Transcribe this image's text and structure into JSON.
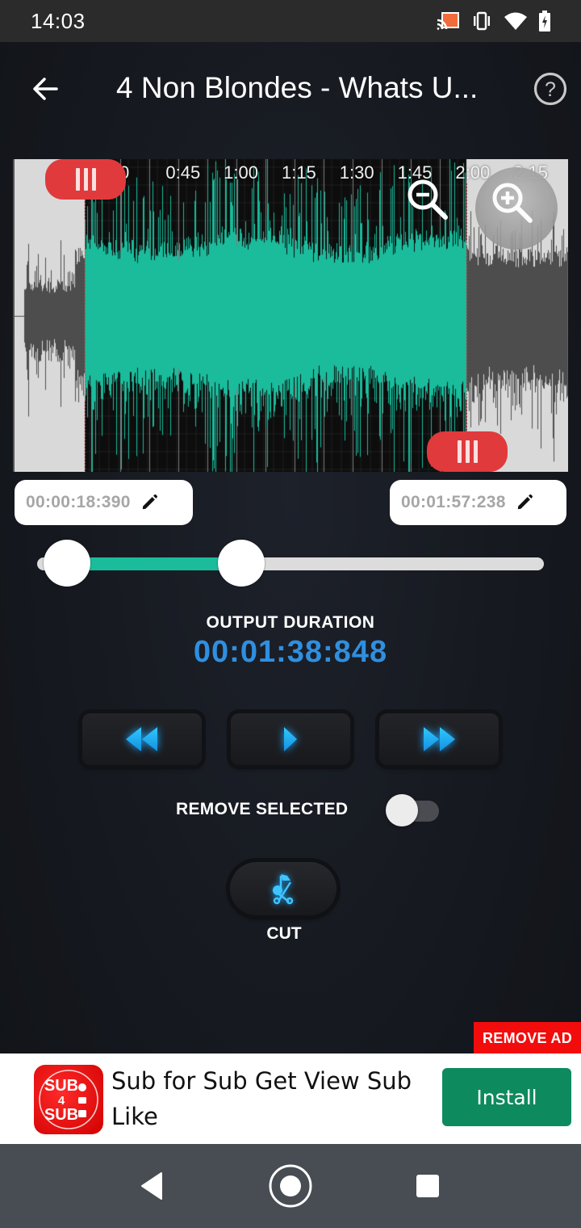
{
  "status_bar": {
    "time": "14:03",
    "icons": [
      "cast-icon",
      "vibrate-icon",
      "wifi-icon",
      "battery-charging-icon"
    ]
  },
  "toolbar": {
    "back_icon": "arrow-left-icon",
    "title": "4 Non Blondes - Whats U...",
    "help_icon": "help-circle-icon"
  },
  "waveform": {
    "time_labels": [
      ":30",
      "0:45",
      "1:00",
      "1:15",
      "1:30",
      "1:45",
      "2:00",
      "2:15"
    ],
    "selection_start_fraction": 0.127,
    "selection_end_fraction": 0.814,
    "colors": {
      "selected": "#1abc9c",
      "unselected": "#4d4d4d",
      "unselected_bg": "#d9d9d9",
      "selected_bg": "#0d0d0d",
      "handle": "#e03a3c"
    },
    "zoom_out_icon": "zoom-out-icon",
    "zoom_in_icon": "zoom-in-icon"
  },
  "trim": {
    "start_time": "00:00:18:390",
    "end_time": "00:01:57:238",
    "edit_icon": "pencil-icon",
    "slider": {
      "start_fraction": 0.0,
      "end_fraction": 0.39,
      "fill_color": "#1abc9c"
    }
  },
  "output": {
    "label": "OUTPUT DURATION",
    "value": "00:01:38:848",
    "value_color": "#2f8fe0"
  },
  "transport": {
    "rewind_icon": "rewind-icon",
    "play_icon": "play-icon",
    "forward_icon": "fast-forward-icon",
    "accent": "#1aa8ff"
  },
  "remove_selected": {
    "label": "REMOVE SELECTED",
    "enabled": false
  },
  "cut": {
    "label": "CUT",
    "icon": "cut-music-icon"
  },
  "ad": {
    "remove_ad_label": "REMOVE AD",
    "app_icon_lines": [
      "SUB",
      "4",
      "SUB"
    ],
    "text": "Sub for Sub Get View Sub Like",
    "install_label": "Install",
    "install_color": "#0e8a5f"
  },
  "nav_bar": {
    "items": [
      "back-icon",
      "home-icon",
      "recents-icon"
    ]
  }
}
